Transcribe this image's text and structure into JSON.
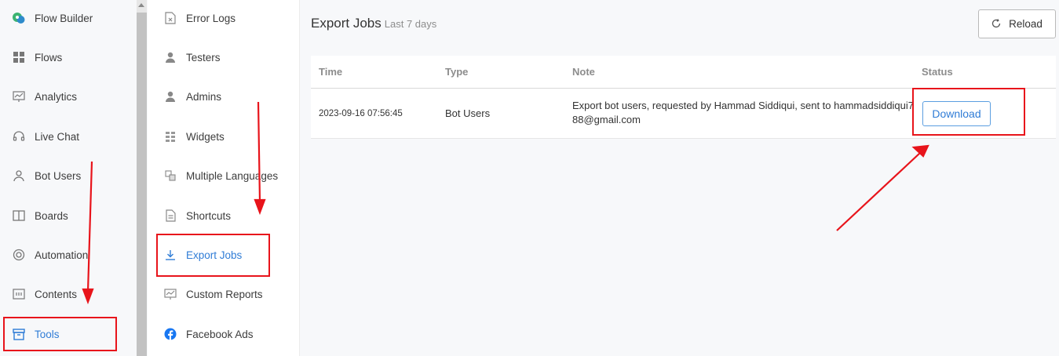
{
  "sidebar": {
    "items": [
      {
        "label": "Flow Builder",
        "icon": "flow-builder-icon"
      },
      {
        "label": "Flows",
        "icon": "grid-icon"
      },
      {
        "label": "Analytics",
        "icon": "chart-board-icon"
      },
      {
        "label": "Live Chat",
        "icon": "headset-icon"
      },
      {
        "label": "Bot Users",
        "icon": "user-icon"
      },
      {
        "label": "Boards",
        "icon": "columns-icon"
      },
      {
        "label": "Automation",
        "icon": "gear-ring-icon"
      },
      {
        "label": "Contents",
        "icon": "content-box-icon"
      },
      {
        "label": "Tools",
        "icon": "toolbox-icon",
        "active": true
      }
    ]
  },
  "submenu": {
    "items": [
      {
        "label": "Error Logs",
        "icon": "error-file-icon"
      },
      {
        "label": "Testers",
        "icon": "person-icon"
      },
      {
        "label": "Admins",
        "icon": "person-icon"
      },
      {
        "label": "Widgets",
        "icon": "widgets-icon"
      },
      {
        "label": "Multiple Languages",
        "icon": "translate-icon"
      },
      {
        "label": "Shortcuts",
        "icon": "document-icon"
      },
      {
        "label": "Export Jobs",
        "icon": "download-icon",
        "active": true
      },
      {
        "label": "Custom Reports",
        "icon": "report-icon"
      },
      {
        "label": "Facebook Ads",
        "icon": "facebook-icon"
      }
    ]
  },
  "main": {
    "title": "Export Jobs",
    "subtitle": "Last 7 days",
    "reload_label": "Reload",
    "columns": [
      "Time",
      "Type",
      "Note",
      "Status"
    ],
    "rows": [
      {
        "time": "2023-09-16 07:56:45",
        "type": "Bot Users",
        "note": "Export bot users, requested by Hammad Siddiqui, sent to hammadsiddiqui788@gmail.com",
        "status_button": "Download"
      }
    ]
  },
  "colors": {
    "accent": "#2f7cd6",
    "annotation": "#e8141b",
    "sidebar_bg": "#f7f8fa"
  }
}
